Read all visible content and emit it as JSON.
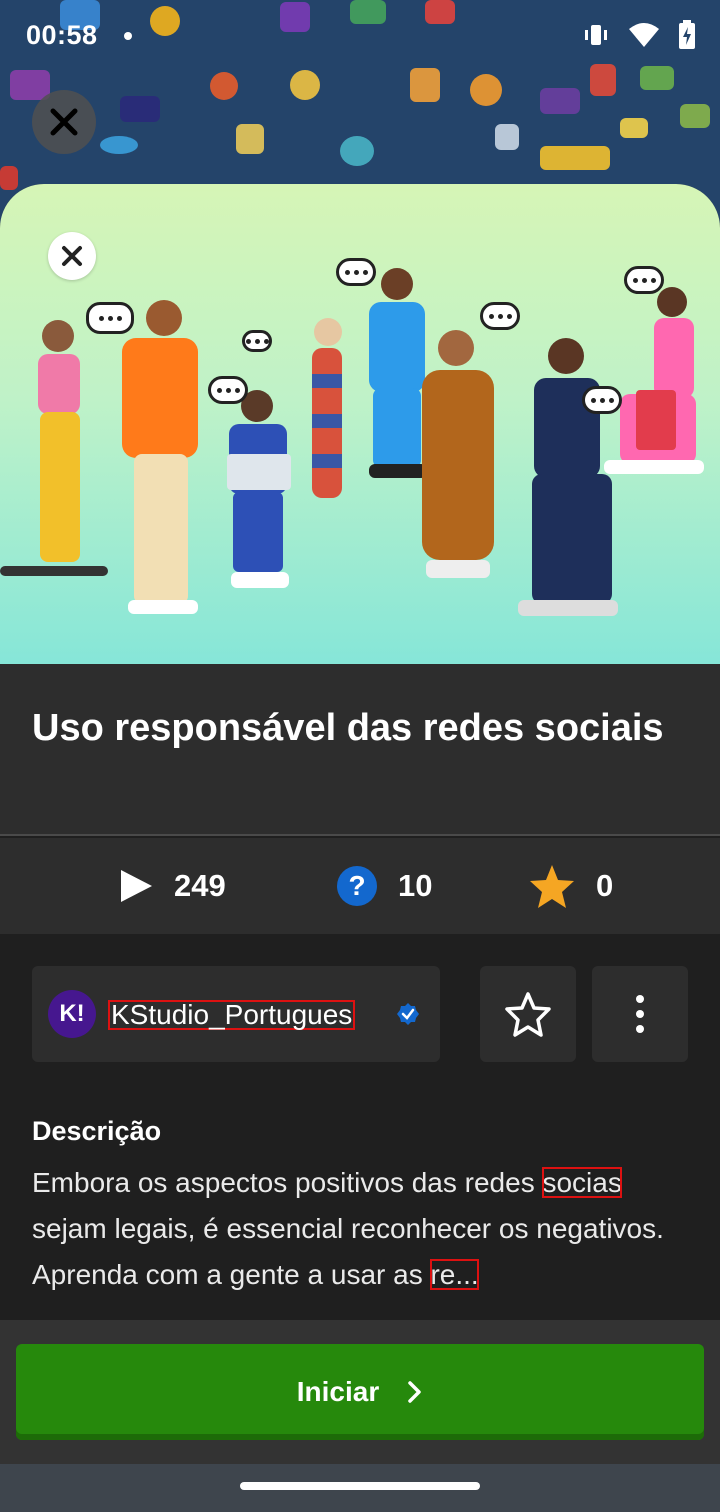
{
  "status_bar": {
    "time": "00:58"
  },
  "quiz": {
    "title": "Uso responsável das redes sociais",
    "plays": "249",
    "questions": "10",
    "favorites": "0"
  },
  "creator": {
    "avatar_text": "K!",
    "name": "KStudio_Portugues"
  },
  "description": {
    "heading": "Descrição",
    "text_1": "Embora os aspectos positivos das redes ",
    "text_2": "socias",
    "text_3": " sejam legais, é essencial reconhecer os negativos. Aprenda com a gente a usar as ",
    "text_4": "re..."
  },
  "actions": {
    "start_label": "Iniciar"
  },
  "colors": {
    "start_button": "#26890c",
    "accent_blue": "#1368ce",
    "star": "#f5a623"
  },
  "icons": [
    "close-icon",
    "play-icon",
    "question-icon",
    "star-icon",
    "verified-icon",
    "star-outline-icon",
    "more-vertical-icon",
    "chevron-right-icon"
  ]
}
